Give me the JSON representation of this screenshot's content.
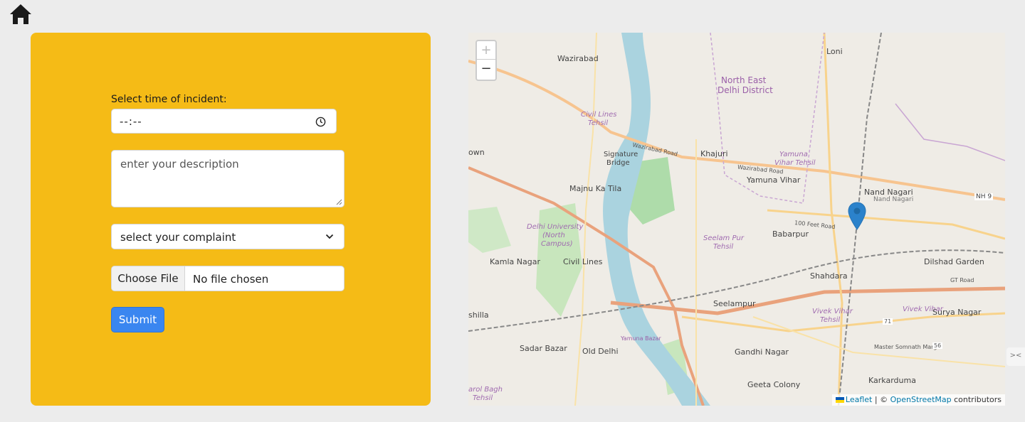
{
  "nav": {
    "home_icon": "home-icon"
  },
  "form": {
    "time_label": "Select time of incident:",
    "time_value": "--:--",
    "description_placeholder": "enter your description",
    "complaint_selected": "select your complaint",
    "choose_file_label": "Choose File",
    "file_status": "No file chosen",
    "submit_label": "Submit",
    "panel_color": "#f5bb16",
    "submit_color": "#3a86f0"
  },
  "map": {
    "zoom_in": "+",
    "zoom_out": "−",
    "attribution": {
      "leaflet": "Leaflet",
      "separator": " | © ",
      "osm": "OpenStreetMap",
      "suffix": " contributors"
    },
    "marker_color": "#2b82cb",
    "labels": {
      "wazirabad": "Wazirabad",
      "loni": "Loni",
      "north_east_1": "North East",
      "north_east_2": "Delhi District",
      "civil_lines_tehsil_1": "Civil Lines",
      "civil_lines_tehsil_2": "Tehsil",
      "signature_1": "Signature",
      "signature_2": "Bridge",
      "khajuri": "Khajuri",
      "yamuna_vihar_tehsil_1": "Yamuna",
      "yamuna_vihar_tehsil_2": "Vihar Tehsil",
      "yamuna_vihar": "Yamuna Vihar",
      "majnu": "Majnu Ka Tila",
      "nand_nagari": "Nand Nagari",
      "nand_nagari_small": "Nand Nagari",
      "nh9": "NH 9",
      "delhi_university_1": "Delhi University",
      "delhi_university_2": "(North",
      "delhi_university_3": "Campus)",
      "seelam_pur_tehsil_1": "Seelam Pur",
      "seelam_pur_tehsil_2": "Tehsil",
      "babarpur": "Babarpur",
      "kamla_nagar": "Kamla Nagar",
      "civil_lines": "Civil Lines",
      "shahdara": "Shahdara",
      "dilshad_garden": "Dilshad Garden",
      "seelampur": "Seelampur",
      "vivek_vihar_tehsil_1": "Vivek Vihar",
      "vivek_vihar_tehsil_2": "Tehsil",
      "surya_nagar": "Surya Nagar",
      "hilla": "shilla",
      "sadar_bazar": "Sadar Bazar",
      "old_delhi": "Old Delhi",
      "gandhi_nagar": "Gandhi Nagar",
      "karkarduma": "Karkarduma",
      "geeta_colony": "Geeta Colony",
      "karol_bagh_1": "arol Bagh",
      "karol_bagh_2": "Tehsil",
      "wazirabad_road": "Wazirabad Road",
      "wazirabad_road_2": "Wazirabad Road",
      "feet_road": "100 Feet Road",
      "gt_road": "GT Road",
      "master_somnath": "Master Somnath Marg",
      "yamuna_bazar": "Yamuna Bazar",
      "own": "own",
      "vivek_vihar": "Vivek Vihar",
      "n71": "71",
      "n56": "56"
    }
  },
  "side_tab": "><"
}
